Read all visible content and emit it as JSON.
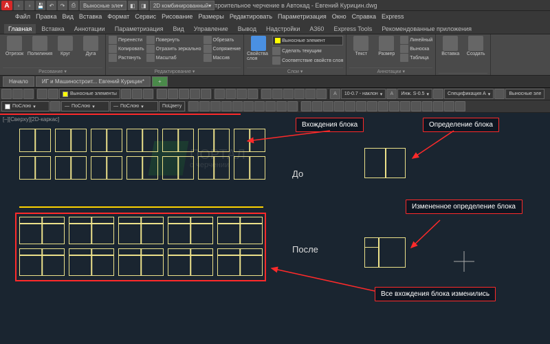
{
  "title": "ИГ и Машиностроительное черчение в Автокад - Евгений Курицин.dwg",
  "qat_combo1": "Выносные эле",
  "qat_combo2": "2D комбинированный",
  "menu": [
    "Файл",
    "Правка",
    "Вид",
    "Вставка",
    "Формат",
    "Сервис",
    "Рисование",
    "Размеры",
    "Редактировать",
    "Параметризация",
    "Окно",
    "Справка",
    "Express"
  ],
  "ribbon_tabs": [
    "Главная",
    "Вставка",
    "Аннотации",
    "Параметризация",
    "Вид",
    "Управление",
    "Вывод",
    "Надстройки",
    "A360",
    "Express Tools",
    "Рекомендованные приложения"
  ],
  "panels": {
    "draw": {
      "name": "Рисование ▾",
      "btns": [
        "Отрезок",
        "Полилиния",
        "Круг",
        "Дуга"
      ]
    },
    "modify": {
      "name": "Редактирование ▾",
      "items": [
        "Перенести",
        "Копировать",
        "Растянуть",
        "Повернуть",
        "Отразить зеркально",
        "Масштаб",
        "Обрезать",
        "Сопряжение",
        "Массив"
      ]
    },
    "layers": {
      "name": "Слои ▾",
      "prop": "Свойства слоя",
      "combo": "Выносные элемент",
      "extra": [
        "Сделать текущим",
        "Соответствие свойств слоя"
      ]
    },
    "anno": {
      "name": "Аннотации ▾",
      "btns": [
        "Текст",
        "Размер"
      ],
      "items": [
        "Линейный",
        "Выноска",
        "Таблица"
      ]
    },
    "block": {
      "name": "",
      "btns": [
        "Вставка",
        "Создать"
      ]
    }
  },
  "doc_tabs": [
    "Начало",
    "ИГ и Машиностроит... Евгений Курицин*"
  ],
  "tb2": {
    "layer_combo": "Выносные элементы",
    "style1": "10-0.7 - наклон",
    "style2": "Инж. S-0.5",
    "style3": "Спецификация А",
    "style4": "Выносные эле"
  },
  "tb3": {
    "c1": "ПоСлою",
    "c2": "ПоСлою",
    "c3": "ПоСлою",
    "c4": "ПоЦвету"
  },
  "viewport_label": "[–][Сверху][2D-каркас]",
  "callouts": {
    "c1": "Вхождения блока",
    "c2": "Определение блока",
    "c3": "Измененное определение блока",
    "c4": "Все вхождения блока изменились"
  },
  "labels": {
    "before": "До",
    "after": "После"
  },
  "watermark": {
    "t1": "ПОРТАЛ",
    "t2": "о черчении"
  }
}
